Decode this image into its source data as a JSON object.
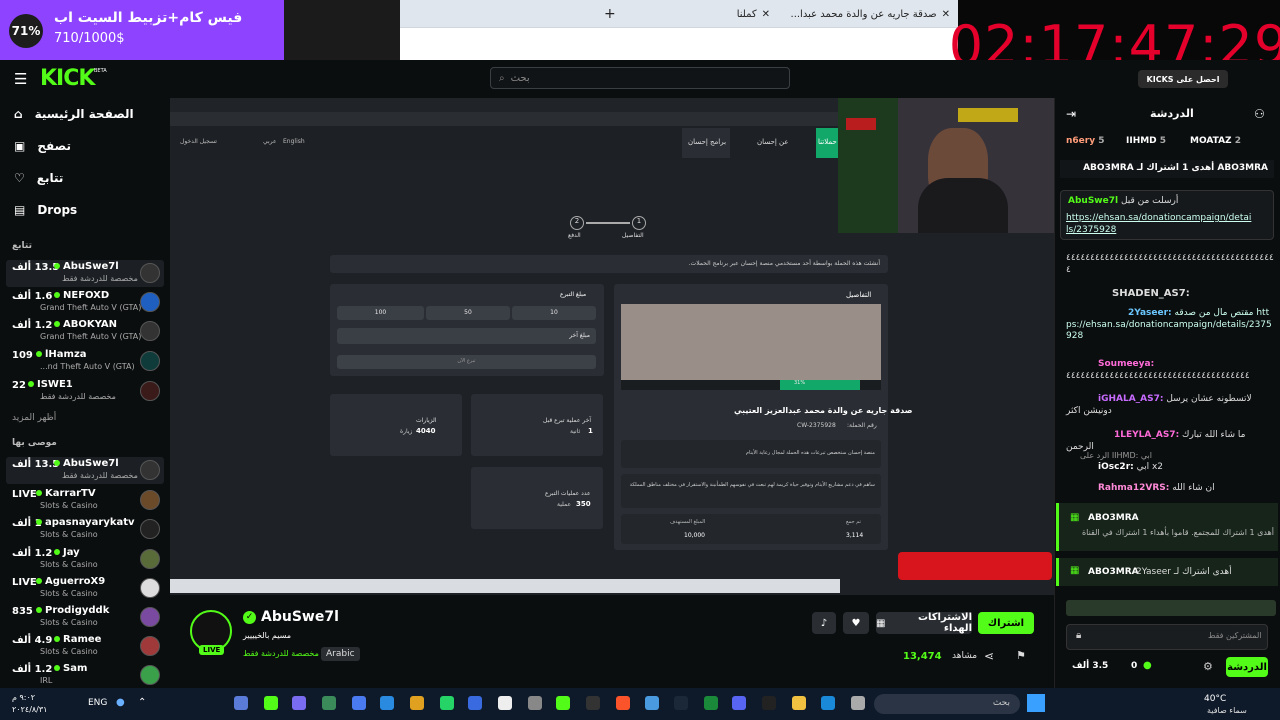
{
  "browser": {
    "tabs": [
      {
        "label": "صدقة جاريه عن والدة محمد عبدا..."
      },
      {
        "label": "كملنا"
      }
    ],
    "new_tab": "+"
  },
  "goal": {
    "percent": "71%",
    "title": "فيس كام+تزبيط السيت اب",
    "value": "710/1000$",
    "progress": 0.71
  },
  "timer": "02:17:47:29",
  "header": {
    "logo": "KICK",
    "beta": "BETA",
    "search_placeholder": "بحث"
  },
  "nav": [
    {
      "label": "الصفحة الرئيسية",
      "icon": "home-icon"
    },
    {
      "label": "تصفح",
      "icon": "browse-icon"
    },
    {
      "label": "تتابع",
      "icon": "heart-icon"
    },
    {
      "label": "Drops",
      "icon": "drops-icon"
    }
  ],
  "sections": {
    "following": "تتابع",
    "show_more": "أظهر المزيد",
    "recommended": "موصى بها"
  },
  "following": [
    {
      "name": "AbuSwe7l",
      "count": "13.5 ألف",
      "cat": "مخصصة للدردشة فقط"
    },
    {
      "name": "NEFOXD",
      "count": "1.6 ألف",
      "cat": "Grand Theft Auto V (GTA)"
    },
    {
      "name": "ABOKYAN",
      "count": "1.2 ألف",
      "cat": "Grand Theft Auto V (GTA)"
    },
    {
      "name": "lHamza",
      "count": "109",
      "cat": "...nd Theft Auto V (GTA)"
    },
    {
      "name": "ISWE1",
      "count": "22",
      "cat": "مخصصة للدردشة فقط"
    }
  ],
  "recommended": [
    {
      "name": "AbuSwe7l",
      "count": "13.5 ألف",
      "cat": "مخصصة للدردشة فقط"
    },
    {
      "name": "KarrarTV",
      "count": "LIVE",
      "cat": "Slots & Casino"
    },
    {
      "name": "apasnayarykatv",
      "count": "1 ألف",
      "cat": "Slots & Casino"
    },
    {
      "name": "Jay",
      "count": "1.2 ألف",
      "cat": "Slots & Casino"
    },
    {
      "name": "AguerroX9",
      "count": "LIVE",
      "cat": "Slots & Casino"
    },
    {
      "name": "Prodigyddk",
      "count": "835",
      "cat": "Slots & Casino"
    },
    {
      "name": "Ramee",
      "count": "4.9 ألف",
      "cat": "Slots & Casino"
    },
    {
      "name": "Sam",
      "count": "1.2 ألف",
      "cat": "IRL"
    }
  ],
  "video": {
    "site_nav": [
      "حملاتنا",
      "عن إحسان",
      "برامج إحسان",
      "English",
      "عربي",
      "تسجيل الدخول"
    ],
    "steps": [
      "التفاصيل",
      "الدفع"
    ],
    "notice": "أنشئت هذه الحملة بواسطة أحد مستخدمي منصة إحسان عبر برنامج الحملات.",
    "details_title": "التفاصيل",
    "amount_title": "مبلغ التبرع",
    "amounts": [
      "10",
      "50",
      "100"
    ],
    "other_amount": "مبلغ آخر",
    "donate_now": "تبرع الآن",
    "campaign_title": "صدقة جاريه عن والدة محمد عبدالعزيز العتيبي",
    "campaign_no_label": "رقم الحملة:",
    "campaign_no": "CW-2375928",
    "desc1": "منصة إحسان ستخصص تبرعات هذه الحملة لمجال رعاية الأيتام",
    "desc2": "ساهم في دعم مشاريع الأيتام وتوفير حياة كريمة لهم تبعث في نفوسهم الطمأنينة والاستقرار في مختلف مناطق المملكة",
    "progress_pct": "31%",
    "collected_label": "تم جمع",
    "collected": "3,114",
    "target_label": "المبلغ المستهدف",
    "target": "10,000",
    "last_donation_label": "آخر عملية تبرع قبل",
    "last_donation": "1",
    "last_donation_unit": "ثانية",
    "visits_label": "الزيارات",
    "visits": "4040",
    "visits_unit": "زيارة",
    "donations_label": "عدد عمليات التبرع",
    "donations": "350",
    "donations_unit": "عملية"
  },
  "stream": {
    "name": "AbuSwe7l",
    "title": "مسيم بالخيييير",
    "category": "مخصصة للدردشة فقط",
    "language": "Arabic",
    "live": "LIVE",
    "viewers_label": "مشاهد",
    "viewers": "13,474",
    "subscribe": "اشتراك",
    "gift": "الاشتراكات الهداء"
  },
  "chat": {
    "title": "الدردشة",
    "leaders": [
      {
        "name": "n6ery",
        "n": "5"
      },
      {
        "name": "IIHMD",
        "n": "5"
      },
      {
        "name": "MOATAZ",
        "n": "2"
      }
    ],
    "gift_banner": "ABO3MRA أهدى 1 اشتراك لـ ABO3MRA",
    "pinned_by": "AbuSwe7l",
    "pinned_label": "أرسلت من قبل",
    "pinned_link": "https://ehsan.sa/donationcampaign/details/2375928",
    "messages": [
      {
        "user": "",
        "text": "٤٤٤٤٤٤٤٤٤٤٤٤٤٤٤٤٤٤٤٤٤٤٤٤٤٤٤٤٤٤٤٤٤٤٤٤٤٤٤٤٤٤٤٤",
        "color": "#ddd"
      },
      {
        "user": "SHADEN_AS7:",
        "text": "",
        "color": "#fff"
      },
      {
        "user": "2Yaseer:",
        "text": "مقتص مال من صدقه https://ehsan.sa/donationcampaign/details/2375928",
        "color": "#6bc7ff"
      },
      {
        "user": "Soumeeya:",
        "text": "٤٤٤٤٤٤٤٤٤٤٤٤٤٤٤٤٤٤٤٤٤٤٤٤٤٤٤٤٤٤٤٤٤٤٤٤٤٤",
        "color": "#ff6bd8"
      },
      {
        "user": "iGHALA_AS7:",
        "text": "لاتسطونه عشان يرسل دونيشن اكثر",
        "color": "#c76bff"
      },
      {
        "user": "1LEYLA_AS7:",
        "text": "ما شاء الله تبارك الرحمن",
        "color": "#ff6bd8"
      },
      {
        "user": "iOsc2r:",
        "text": "ابي x2",
        "color": "#fff"
      },
      {
        "user": "Rahma12VRS:",
        "text": "ان شاء الله",
        "color": "#ff8ad8"
      }
    ],
    "reply_hint": "الرد على IIHMD: ابي",
    "event1_user": "ABO3MRA",
    "event1_text": "أهدى 1 اشتراك للمجتمع. قاموا بأهداء 1 اشتراك في القناة",
    "event2_user": "ABO3MRA",
    "event2_text": "أهدى اشتراك لـ 2Yaseer",
    "input_placeholder": "المشتركين فقط",
    "send": "الدردشة",
    "points": "0",
    "kicks": "3.5 ألف",
    "subscribe_kicks": "KICKS احصل على"
  },
  "taskbar": {
    "weather_temp": "40°C",
    "weather_desc": "سماء صافية",
    "lang": "ENG",
    "time": "٩:٠٢ م",
    "date": "٢٠٢٤/٨/٣١",
    "search": "بحث"
  }
}
